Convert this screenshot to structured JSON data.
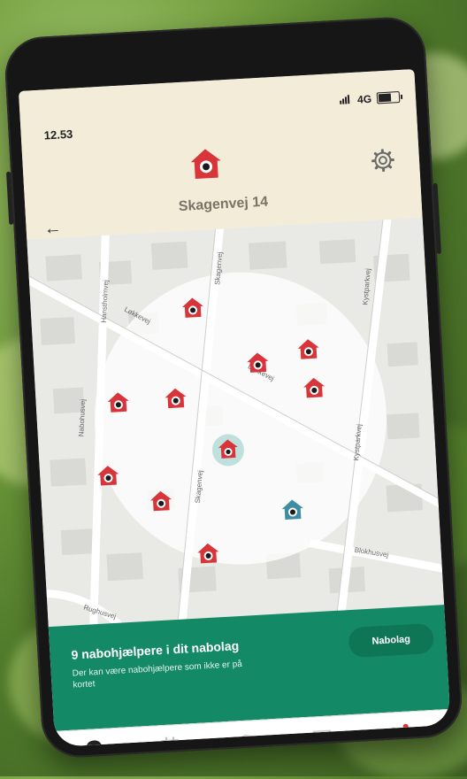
{
  "status_bar": {
    "time": "12.53",
    "network": "4G"
  },
  "header": {
    "title": "Skagenvej 14",
    "back_icon": "arrow-left-icon",
    "settings_icon": "gear-icon",
    "home_icon": "house-icon"
  },
  "map": {
    "street_labels": [
      "Skagenvej",
      "Løkkevej",
      "Løkkevej",
      "Nabohusvej",
      "Kystparkvej",
      "Kystparkvej",
      "Blokhusvej",
      "Skagenvej",
      "Hanstholmvej",
      "Rughusvej"
    ],
    "pin_color": "#d8353a",
    "you_pin_color": "#3d8da3"
  },
  "banner": {
    "title": "9 nabohjælpere i dit nabolag",
    "subtitle": "Der kan være nabohjælpere som ikke er på kortet",
    "button_label": "Nabolag",
    "color": "#138a65"
  },
  "tabbar": {
    "items": [
      "map-pin-icon",
      "calendar-icon",
      "alarm-bell-icon",
      "chat-question-icon",
      "people-icon"
    ]
  }
}
